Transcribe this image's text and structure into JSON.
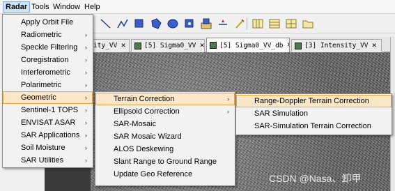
{
  "menubar": {
    "items": [
      {
        "label": "Radar",
        "active": true
      },
      {
        "label": "Tools"
      },
      {
        "label": "Window"
      },
      {
        "label": "Help"
      }
    ]
  },
  "toolbar": {
    "icons": [
      "line-tool-icon",
      "polyline-tool-icon",
      "rectangle-tool-icon",
      "polygon-tool-icon",
      "ellipse-tool-icon",
      "pin-tool-icon",
      "gcp-tool-icon",
      "magic-wand-icon",
      "range-finder-icon",
      "grid-layout-1-icon",
      "grid-layout-2-icon",
      "grid-layout-3-icon",
      "folder-icon"
    ]
  },
  "tabs": [
    {
      "label": "ity_VV"
    },
    {
      "label": "[5] Sigma0_VV"
    },
    {
      "label": "[5] Sigma0_VV_db",
      "active": true
    },
    {
      "label": "[3] Intensity_VV"
    }
  ],
  "tab_close": "✕",
  "radar_menu": {
    "items": [
      {
        "label": "Apply Orbit File",
        "submenu": false
      },
      {
        "label": "Radiometric",
        "submenu": true
      },
      {
        "label": "Speckle Filtering",
        "submenu": true
      },
      {
        "label": "Coregistration",
        "submenu": true
      },
      {
        "label": "Interferometric",
        "submenu": true
      },
      {
        "label": "Polarimetric",
        "submenu": true
      },
      {
        "label": "Geometric",
        "submenu": true,
        "highlighted": true
      },
      {
        "label": "Sentinel-1 TOPS",
        "submenu": true
      },
      {
        "label": "ENVISAT ASAR",
        "submenu": true
      },
      {
        "label": "SAR Applications",
        "submenu": true
      },
      {
        "label": "Soil Moisture",
        "submenu": true
      },
      {
        "label": "SAR Utilities",
        "submenu": true
      }
    ]
  },
  "geometric_menu": {
    "items": [
      {
        "label": "Terrain Correction",
        "submenu": true,
        "highlighted": true
      },
      {
        "label": "Ellipsoid Correction",
        "submenu": true
      },
      {
        "label": "SAR-Mosaic",
        "submenu": false
      },
      {
        "label": "SAR Mosaic Wizard",
        "submenu": false
      },
      {
        "label": "ALOS Deskewing",
        "submenu": false
      },
      {
        "label": "Slant Range to Ground Range",
        "submenu": false
      },
      {
        "label": "Update Geo Reference",
        "submenu": false
      }
    ]
  },
  "terrain_menu": {
    "items": [
      {
        "label": "Range-Doppler Terrain Correction",
        "highlighted": true
      },
      {
        "label": "SAR Simulation"
      },
      {
        "label": "SAR-Simulation Terrain Correction"
      }
    ]
  },
  "submenu_arrow": "›",
  "watermark": "CSDN @Nasa、卸甲"
}
